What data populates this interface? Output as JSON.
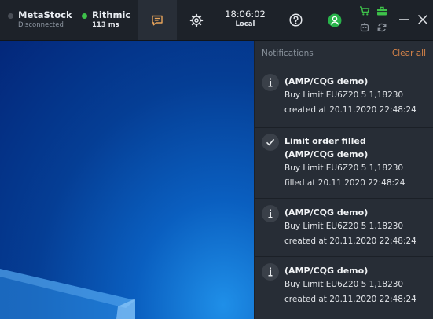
{
  "connections": [
    {
      "name": "MetaStock",
      "status": "Disconnected",
      "dot_color": "#4a4f57"
    },
    {
      "name": "Rithmic",
      "status": "113 ms",
      "dot_color": "#3ec24a"
    }
  ],
  "clock": {
    "time": "18:06:02",
    "zone": "Local"
  },
  "colors": {
    "accent_orange": "#d88449",
    "user_green": "#28b34a",
    "status_green": "#3ec24a"
  },
  "toolbar_icons": [
    "chat-icon",
    "gear-icon",
    "help-icon",
    "user-icon",
    "cart-icon",
    "briefcase-icon",
    "robot-icon",
    "refresh-icon",
    "minimize-icon",
    "close-icon"
  ],
  "notifications_panel": {
    "title": "Notifications",
    "clear_all": "Clear all",
    "items": [
      {
        "icon": "info-icon",
        "title_lines": [
          "(AMP/CQG demo)"
        ],
        "line1": "Buy Limit EU6Z20 5 1,18230",
        "line2": "created at 20.11.2020 22:48:24"
      },
      {
        "icon": "check-icon",
        "title_lines": [
          "Limit order filled",
          "(AMP/CQG demo)"
        ],
        "line1": "Buy Limit EU6Z20 5 1,18230",
        "line2": "filled at 20.11.2020 22:48:24"
      },
      {
        "icon": "info-icon",
        "title_lines": [
          "(AMP/CQG demo)"
        ],
        "line1": "Buy Limit EU6Z20 5 1,18230",
        "line2": "created at 20.11.2020 22:48:24"
      },
      {
        "icon": "info-icon",
        "title_lines": [
          "(AMP/CQG demo)"
        ],
        "line1": "Buy Limit EU6Z20 5 1,18230",
        "line2": "created at 20.11.2020 22:48:24"
      }
    ]
  }
}
